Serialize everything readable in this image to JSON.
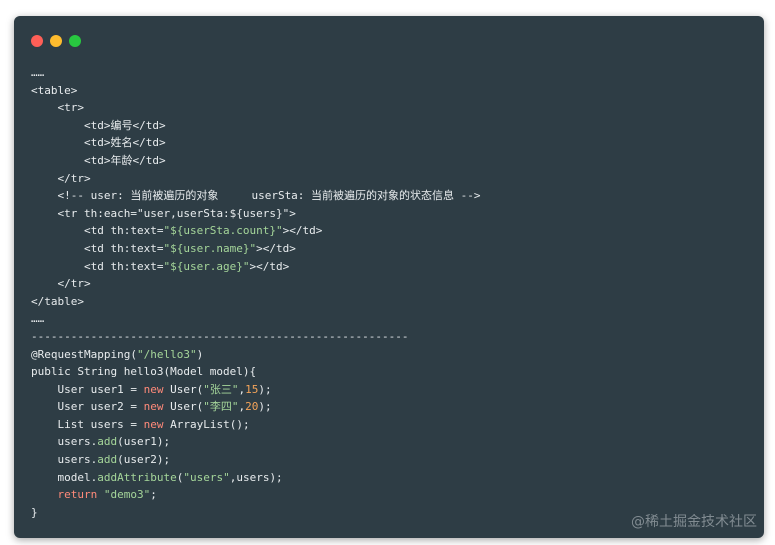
{
  "window_controls": {
    "close_color": "#fe5f57",
    "minimize_color": "#febc2e",
    "maximize_color": "#28c840"
  },
  "colors": {
    "default": "#e8ecee",
    "string": "#a5d69a",
    "keyword": "#ff8a7a",
    "number": "#f4a45a",
    "method": "#a5d69a"
  },
  "code_lines": [
    [
      {
        "t": "……",
        "c": "default"
      }
    ],
    [
      {
        "t": "<table>",
        "c": "default"
      }
    ],
    [
      {
        "t": "    <tr>",
        "c": "default"
      }
    ],
    [
      {
        "t": "        <td>编号</td>",
        "c": "default"
      }
    ],
    [
      {
        "t": "        <td>姓名</td>",
        "c": "default"
      }
    ],
    [
      {
        "t": "        <td>年龄</td>",
        "c": "default"
      }
    ],
    [
      {
        "t": "    </tr>",
        "c": "default"
      }
    ],
    [
      {
        "t": "    <!-- user: 当前被遍历的对象     userSta: 当前被遍历的对象的状态信息 -->",
        "c": "default"
      }
    ],
    [
      {
        "t": "    <tr th:each=",
        "c": "default"
      },
      {
        "t": "\"user,userSta:${users}\"",
        "c": "default"
      },
      {
        "t": ">",
        "c": "default"
      }
    ],
    [
      {
        "t": "        <td th:text=",
        "c": "default"
      },
      {
        "t": "\"${userSta.count}\"",
        "c": "string"
      },
      {
        "t": "></td>",
        "c": "default"
      }
    ],
    [
      {
        "t": "        <td th:text=",
        "c": "default"
      },
      {
        "t": "\"${user.name}\"",
        "c": "string"
      },
      {
        "t": "></td>",
        "c": "default"
      }
    ],
    [
      {
        "t": "        <td th:text=",
        "c": "default"
      },
      {
        "t": "\"${user.age}\"",
        "c": "string"
      },
      {
        "t": "></td>",
        "c": "default"
      }
    ],
    [
      {
        "t": "    </tr>",
        "c": "default"
      }
    ],
    [
      {
        "t": "</table>",
        "c": "default"
      }
    ],
    [
      {
        "t": "……",
        "c": "default"
      }
    ],
    [
      {
        "t": "---------------------------------------------------------",
        "c": "default"
      }
    ],
    [
      {
        "t": "@RequestMapping(",
        "c": "default"
      },
      {
        "t": "\"/hello3\"",
        "c": "string"
      },
      {
        "t": ")",
        "c": "default"
      }
    ],
    [
      {
        "t": "public String hello3(Model model){",
        "c": "default"
      }
    ],
    [
      {
        "t": "    User user1 = ",
        "c": "default"
      },
      {
        "t": "new",
        "c": "keyword"
      },
      {
        "t": " User(",
        "c": "default"
      },
      {
        "t": "\"张三\"",
        "c": "string"
      },
      {
        "t": ",",
        "c": "default"
      },
      {
        "t": "15",
        "c": "number"
      },
      {
        "t": ");",
        "c": "default"
      }
    ],
    [
      {
        "t": "    User user2 = ",
        "c": "default"
      },
      {
        "t": "new",
        "c": "keyword"
      },
      {
        "t": " User(",
        "c": "default"
      },
      {
        "t": "\"李四\"",
        "c": "string"
      },
      {
        "t": ",",
        "c": "default"
      },
      {
        "t": "20",
        "c": "number"
      },
      {
        "t": ");",
        "c": "default"
      }
    ],
    [
      {
        "t": "    List users = ",
        "c": "default"
      },
      {
        "t": "new",
        "c": "keyword"
      },
      {
        "t": " ArrayList();",
        "c": "default"
      }
    ],
    [
      {
        "t": "    users.",
        "c": "default"
      },
      {
        "t": "add",
        "c": "method"
      },
      {
        "t": "(user1);",
        "c": "default"
      }
    ],
    [
      {
        "t": "    users.",
        "c": "default"
      },
      {
        "t": "add",
        "c": "method"
      },
      {
        "t": "(user2);",
        "c": "default"
      }
    ],
    [
      {
        "t": "    model.",
        "c": "default"
      },
      {
        "t": "addAttribute",
        "c": "method"
      },
      {
        "t": "(",
        "c": "default"
      },
      {
        "t": "\"users\"",
        "c": "string"
      },
      {
        "t": ",users);",
        "c": "default"
      }
    ],
    [
      {
        "t": "    ",
        "c": "default"
      },
      {
        "t": "return",
        "c": "keyword"
      },
      {
        "t": " ",
        "c": "default"
      },
      {
        "t": "\"demo3\"",
        "c": "string"
      },
      {
        "t": ";",
        "c": "default"
      }
    ],
    [
      {
        "t": "}",
        "c": "default"
      }
    ]
  ],
  "watermark": "@稀土掘金技术社区"
}
